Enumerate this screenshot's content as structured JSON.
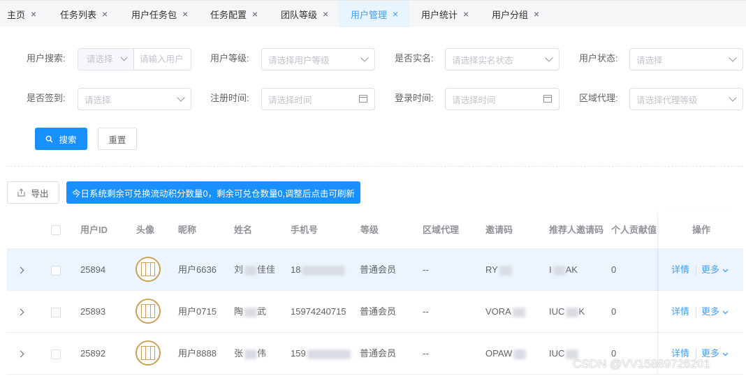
{
  "tabs": [
    {
      "label": "主页",
      "active": false
    },
    {
      "label": "任务列表",
      "active": false
    },
    {
      "label": "用户任务包",
      "active": false
    },
    {
      "label": "任务配置",
      "active": false
    },
    {
      "label": "团队等级",
      "active": false
    },
    {
      "label": "用户管理",
      "active": true
    },
    {
      "label": "用户统计",
      "active": false
    },
    {
      "label": "用户分组",
      "active": false
    }
  ],
  "tab_close": "×",
  "filters": {
    "user_search_label": "用户搜索:",
    "user_search_select": "请选择",
    "user_search_input_placeholder": "请输入用户",
    "level_label": "用户等级:",
    "level_placeholder": "请选择用户等级",
    "realname_label": "是否实名:",
    "realname_placeholder": "请选择实名状态",
    "status_label": "用户状态:",
    "status_placeholder": "请选择",
    "signin_label": "是否签到:",
    "signin_placeholder": "请选择",
    "register_label": "注册时间:",
    "register_placeholder": "请选择时间",
    "login_label": "登录时间:",
    "login_placeholder": "请选择时间",
    "agent_label": "区域代理:",
    "agent_placeholder": "请选择代理等级"
  },
  "buttons": {
    "search": "搜索",
    "reset": "重置",
    "export": "导出"
  },
  "notice": "今日系统剩余可兑换流动积分数量0，剩余可兑仓数量0,调整后点击可刷新",
  "table": {
    "headers": [
      "用户ID",
      "头像",
      "昵称",
      "姓名",
      "手机号",
      "等级",
      "区域代理",
      "邀请码",
      "推荐人邀请码",
      "个人贡献值",
      "操作"
    ],
    "rows": [
      {
        "id": "25894",
        "nickname": "用户6636",
        "name_a": "刘",
        "name_b": "佳佳",
        "phone": "18",
        "level": "普通会员",
        "agent": "--",
        "invite": "RY",
        "referrer_a": "I",
        "referrer_b": "AK",
        "contribution": "0"
      },
      {
        "id": "25893",
        "nickname": "用户0715",
        "name_a": "陶",
        "name_b": "武",
        "phone": "15974240715",
        "level": "普通会员",
        "agent": "--",
        "invite": "VORA",
        "referrer_a": "IUC",
        "referrer_b": "K",
        "contribution": "0"
      },
      {
        "id": "25892",
        "nickname": "用户8888",
        "name_a": "张",
        "name_b": "伟",
        "phone": "159",
        "level": "普通会员",
        "agent": "--",
        "invite": "OPAW",
        "referrer_a": "IUC",
        "referrer_b": "",
        "contribution": "0"
      }
    ],
    "detail_label": "详情",
    "more_label": "更多"
  },
  "watermark": "CSDN @VV15889726201"
}
